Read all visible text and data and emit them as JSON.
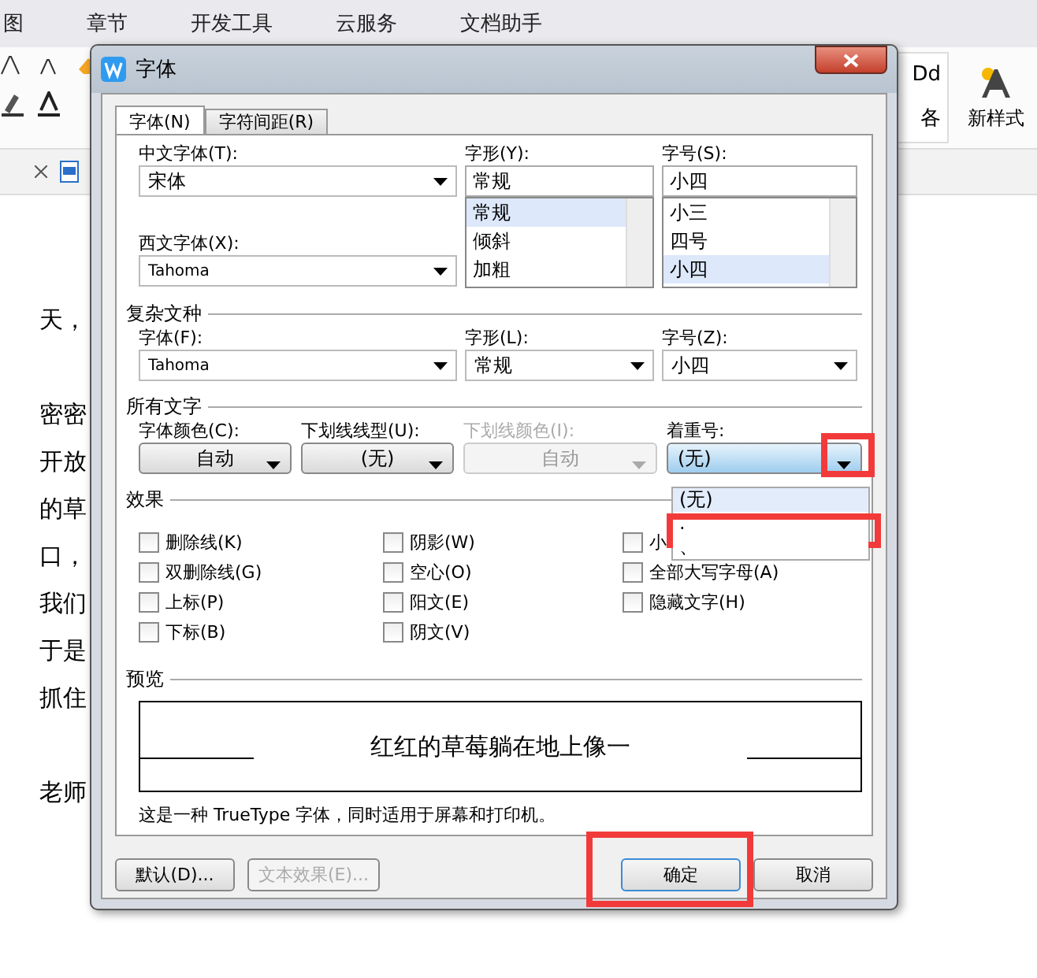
{
  "menu_bar": [
    "图",
    "章节",
    "开发工具",
    "云服务",
    "文档助手"
  ],
  "style_gallery": {
    "sample": "Dd",
    "label": "各"
  },
  "new_style_button": "新样式",
  "document_lines": [
    "天，",
    "密密",
    "开放",
    "的草",
    "口，",
    "我们",
    "于是",
    "抓住",
    "老师"
  ],
  "dialog": {
    "title": "字体",
    "tabs": [
      {
        "label": "字体(N)",
        "selected": true
      },
      {
        "label": "字符间距(R)",
        "selected": false
      }
    ],
    "chinese_font": {
      "label": "中文字体(T):",
      "value": "宋体"
    },
    "western_font": {
      "label": "西文字体(X):",
      "value": "Tahoma"
    },
    "style": {
      "label": "字形(Y):",
      "value": "常规",
      "options": [
        {
          "label": "常规",
          "selected": true
        },
        {
          "label": "倾斜",
          "selected": false
        },
        {
          "label": "加粗",
          "selected": false
        }
      ]
    },
    "size": {
      "label": "字号(S):",
      "value": "小四",
      "options": [
        {
          "label": "小三",
          "selected": false
        },
        {
          "label": "四号",
          "selected": false
        },
        {
          "label": "小四",
          "selected": true
        }
      ]
    },
    "complex_script": {
      "heading": "复杂文种",
      "fields": [
        {
          "label": "字体(F):",
          "value": "Tahoma"
        },
        {
          "label": "字形(L):",
          "value": "常规"
        },
        {
          "label": "字号(Z):",
          "value": "小四"
        }
      ]
    },
    "all_text": {
      "heading": "所有文字",
      "fields": [
        {
          "label": "字体颜色(C):",
          "value": "自动",
          "disabled": false,
          "open": false
        },
        {
          "label": "下划线线型(U):",
          "value": "(无)",
          "disabled": false,
          "open": false
        },
        {
          "label": "下划线颜色(I):",
          "value": "自动",
          "disabled": true,
          "open": false
        },
        {
          "label": "着重号:",
          "value": "(无)",
          "disabled": false,
          "open": true,
          "highlighted": true
        }
      ]
    },
    "emphasis_options": [
      {
        "label": "(无)",
        "selected": true
      },
      {
        "label": ".",
        "selected": false,
        "highlighted": true
      },
      {
        "label": "、",
        "selected": false
      }
    ],
    "effects": {
      "heading": "效果",
      "columns": [
        [
          {
            "label": "删除线(K)",
            "checked": false
          },
          {
            "label": "双删除线(G)",
            "checked": false
          },
          {
            "label": "上标(P)",
            "checked": false
          },
          {
            "label": "下标(B)",
            "checked": false
          }
        ],
        [
          {
            "label": "阴影(W)",
            "checked": false
          },
          {
            "label": "空心(O)",
            "checked": false
          },
          {
            "label": "阳文(E)",
            "checked": false
          },
          {
            "label": "阴文(V)",
            "checked": false
          }
        ],
        [
          {
            "label": "小",
            "checked": false
          },
          {
            "label": "全部大写字母(A)",
            "checked": false
          },
          {
            "label": "隐藏文字(H)",
            "checked": false
          }
        ]
      ]
    },
    "preview": {
      "heading": "预览",
      "sample": "红红的草莓躺在地上像一",
      "note": "这是一种 TrueType 字体，同时适用于屏幕和打印机。"
    },
    "buttons": [
      {
        "label": "默认(D)...",
        "disabled": false,
        "default": false
      },
      {
        "label": "文本效果(E)...",
        "disabled": true,
        "default": false
      },
      {
        "label": "确定",
        "disabled": false,
        "default": true,
        "highlighted": true
      },
      {
        "label": "取消",
        "disabled": false,
        "default": false
      }
    ]
  }
}
